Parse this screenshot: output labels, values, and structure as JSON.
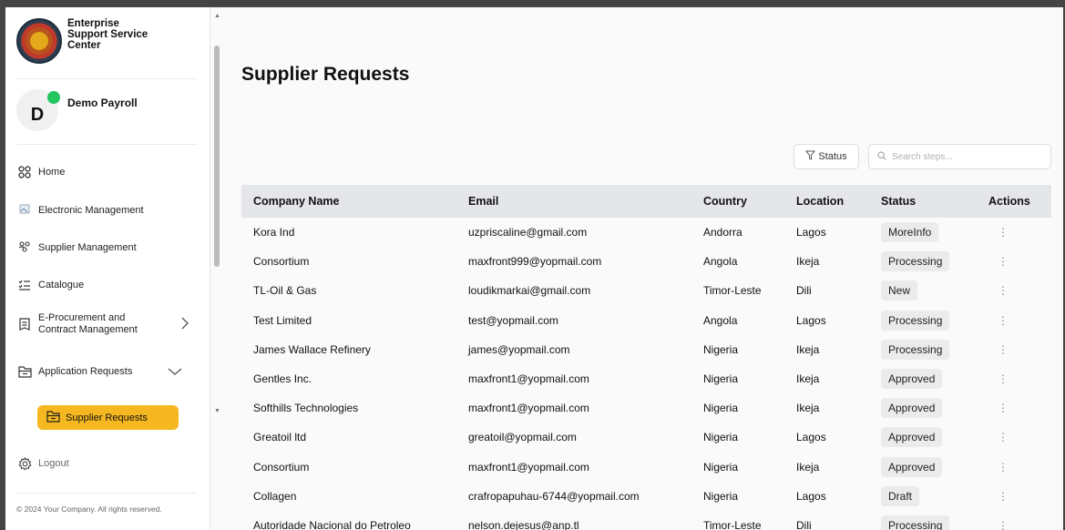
{
  "brand": {
    "name": "Enterprise Support Service Center"
  },
  "user": {
    "initial": "D",
    "name": "Demo Payroll"
  },
  "sidebar": {
    "items": [
      {
        "label": "Home",
        "icon": "home-grid-icon"
      },
      {
        "label": "Electronic Management",
        "icon": "broken-image-icon"
      },
      {
        "label": "Supplier Management",
        "icon": "users-icon"
      },
      {
        "label": "Catalogue",
        "icon": "list-icon"
      },
      {
        "label": "E-Procurement and Contract Management",
        "icon": "document-icon"
      },
      {
        "label": "Application Requests",
        "icon": "folder-icon"
      }
    ],
    "active": {
      "label": "Supplier Requests",
      "icon": "folder-icon"
    },
    "logout": "Logout",
    "copyright": "© 2024 Your Company. All rights reserved."
  },
  "page": {
    "title": "Supplier Requests"
  },
  "filters": {
    "status_label": "Status",
    "search_placeholder": "Search steps..."
  },
  "table": {
    "columns": [
      "Company Name",
      "Email",
      "Country",
      "Location",
      "Status",
      "Actions"
    ],
    "rows": [
      [
        "Kora Ind",
        "uzpriscaline@gmail.com",
        "Andorra",
        "Lagos",
        "MoreInfo"
      ],
      [
        "Consortium",
        "maxfront999@yopmail.com",
        "Angola",
        "Ikeja",
        "Processing"
      ],
      [
        "TL-Oil & Gas",
        "loudikmarkai@gmail.com",
        "Timor-Leste",
        "Dili",
        "New"
      ],
      [
        "Test Limited",
        "test@yopmail.com",
        "Angola",
        "Lagos",
        "Processing"
      ],
      [
        "James Wallace Refinery",
        "james@yopmail.com",
        "Nigeria",
        "Ikeja",
        "Processing"
      ],
      [
        "Gentles Inc.",
        "maxfront1@yopmail.com",
        "Nigeria",
        "Ikeja",
        "Approved"
      ],
      [
        "Softhills Technologies",
        "maxfront1@yopmail.com",
        "Nigeria",
        "Ikeja",
        "Approved"
      ],
      [
        "Greatoil ltd",
        "greatoil@yopmail.com",
        "Nigeria",
        "Lagos",
        "Approved"
      ],
      [
        "Consortium",
        "maxfront1@yopmail.com",
        "Nigeria",
        "Ikeja",
        "Approved"
      ],
      [
        "Collagen",
        "crafropapuhau-6744@yopmail.com",
        "Nigeria",
        "Lagos",
        "Draft"
      ],
      [
        "Autoridade Nacional do Petroleo",
        "nelson.dejesus@anp.tl",
        "Timor-Leste",
        "Dili",
        "Processing"
      ]
    ]
  },
  "colors": {
    "accent": "#f6b820",
    "online": "#22c55e",
    "header_bg": "#e4e6ea"
  }
}
